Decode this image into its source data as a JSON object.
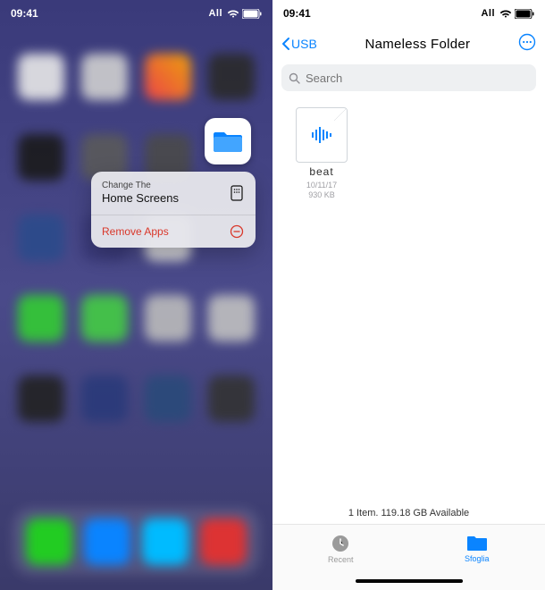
{
  "left": {
    "status": {
      "time": "09:41",
      "carrier": "All"
    },
    "files_icon": "folder-icon",
    "context_menu": {
      "change_line1": "Change The",
      "change_line2": "Home Screens",
      "remove_label": "Remove Apps"
    }
  },
  "right": {
    "status": {
      "time": "09:41",
      "carrier": "All"
    },
    "nav": {
      "back_label": "USB",
      "title": "Nameless Folder"
    },
    "search": {
      "placeholder": "Search"
    },
    "files": [
      {
        "name": "beat",
        "date": "10/11/17",
        "size": "930 KB",
        "icon": "audio-waveform-icon"
      }
    ],
    "footer": "1 Item. 119.18 GB Available",
    "tabs": {
      "recent": "Recent",
      "browse": "Sfoglia"
    }
  }
}
